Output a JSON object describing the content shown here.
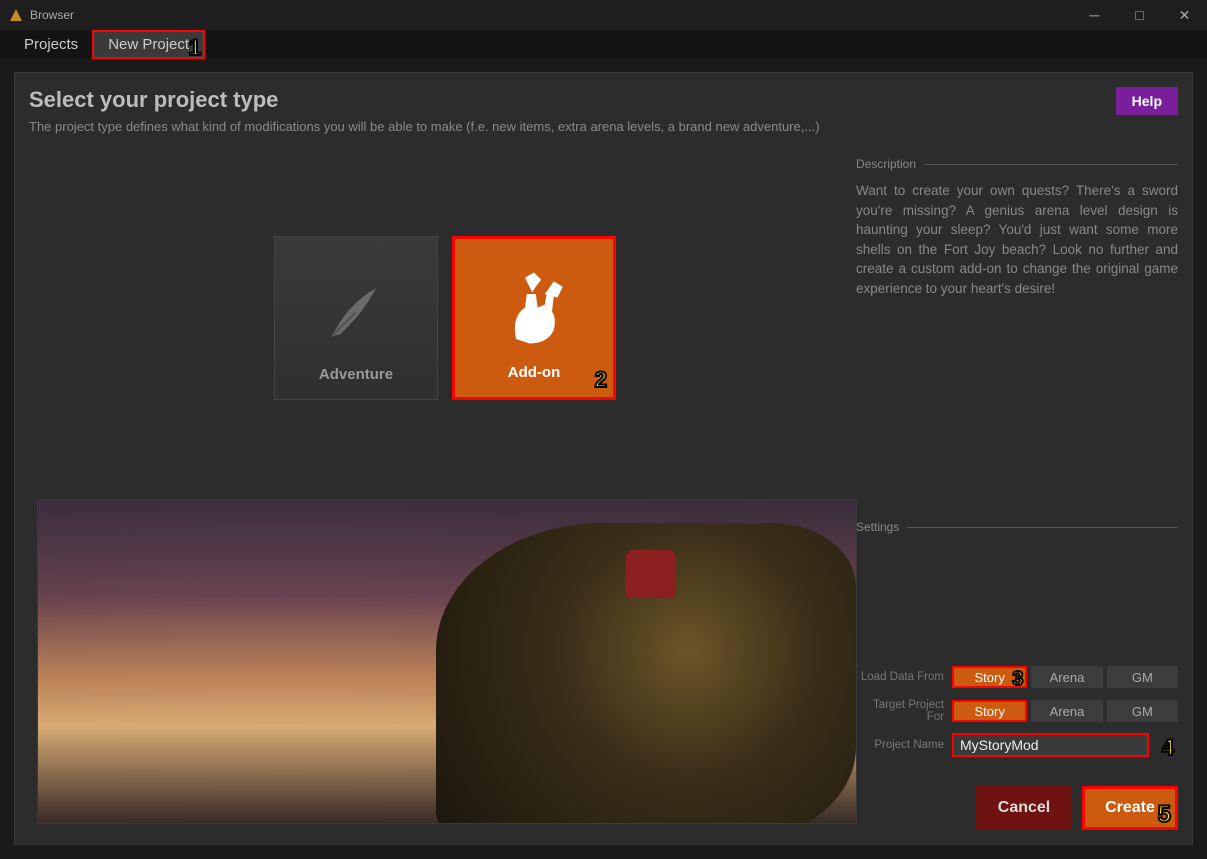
{
  "window": {
    "title": "Browser"
  },
  "tabs": {
    "projects": "Projects",
    "new_project": "New Project"
  },
  "overlay": {
    "tab": "1",
    "card": "2",
    "seg": "3",
    "name": "4",
    "create": "5"
  },
  "header": {
    "title": "Select your project type",
    "subtitle": "The project type defines what kind of modifications you will be able to make (f.e. new items, extra arena levels, a brand new adventure,...)",
    "help": "Help"
  },
  "cards": {
    "adventure": {
      "label": "Adventure"
    },
    "addon": {
      "label": "Add-on"
    }
  },
  "description": {
    "section": "Description",
    "text": "Want to create your own quests? There's a sword you're missing? A genius arena level design is haunting your sleep? You'd just want some more shells on the Fort Joy beach? Look no further and create a custom add-on to change the original game experience to your heart's desire!"
  },
  "settings": {
    "section": "Settings",
    "load_label": "Load Data From",
    "target_label": "Target Project For",
    "name_label": "Project Name",
    "options": {
      "story": "Story",
      "arena": "Arena",
      "gm": "GM"
    },
    "project_name": "MyStoryMod"
  },
  "actions": {
    "cancel": "Cancel",
    "create": "Create"
  }
}
